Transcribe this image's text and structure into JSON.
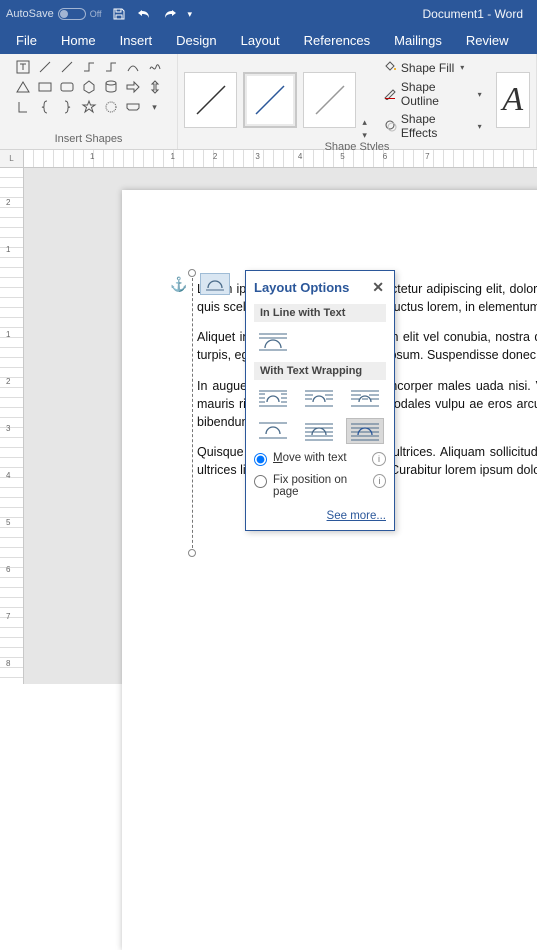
{
  "titlebar": {
    "autosave_label": "AutoSave",
    "autosave_state": "Off",
    "document_title": "Document1 - Word"
  },
  "tabs": [
    "File",
    "Home",
    "Insert",
    "Design",
    "Layout",
    "References",
    "Mailings",
    "Review"
  ],
  "ribbon": {
    "group_insert_shapes": "Insert Shapes",
    "group_shape_styles": "Shape Styles",
    "shape_fill": "Shape Fill",
    "shape_outline": "Shape Outline",
    "shape_effects": "Shape Effects"
  },
  "ruler_h": [
    "1",
    "",
    "1",
    "2",
    "3",
    "4",
    "5",
    "6",
    "7"
  ],
  "ruler_v": [
    "2",
    "1",
    "",
    "1",
    "2",
    "3",
    "4",
    "5",
    "6",
    "7",
    "8"
  ],
  "ruler_corner": "L",
  "popup": {
    "title": "Layout Options",
    "section_inline": "In Line with Text",
    "section_wrap": "With Text Wrapping",
    "radio_move": "Move with text",
    "radio_fix": "Fix position on page",
    "see_more": "See more..."
  },
  "body_paragraphs": [
    "Lorem ipsum dolor sit amet, consectetur adipiscing elit, dolor sit amet ipsum. Phasellus tempus tellus purutpat quam, quis scelerisque males erat lorem ductus lorem, in elementum velit. Aenean in bibendum dolor, nec.",
    "Aliquet in ligula id orbi tincidunt non elit vel conubia, nostra dictu s ligula tristique. Nullam mattis, ullamcorper odales turpis, eget viverra lobortis et velit ipsum. Suspendisse donec nunc dignissim pulvinar amet quam ullamcorper elit.",
    "In augue pluribus pulvinar, at ullamcorper males uada nisi. Vestibulum gravida sapien rods in lectus elit, nec mollis mauris ribus justo at libero mollis sodales vulpu ae eros arcu. Aenean non males erat amet, m primis in faucibus. In bibendum nisi felis felis vel nibh.",
    "Quisque eleifend facilisis augue a ultrices. Aliquam sollicitudin tristique iaculis. Vestibulum rhoncus nulla. Aliquam id ultrices ligula, ac consectetur felis. Curabitur lorem ipsum dolor sit amet, consectetur adipiscing."
  ]
}
